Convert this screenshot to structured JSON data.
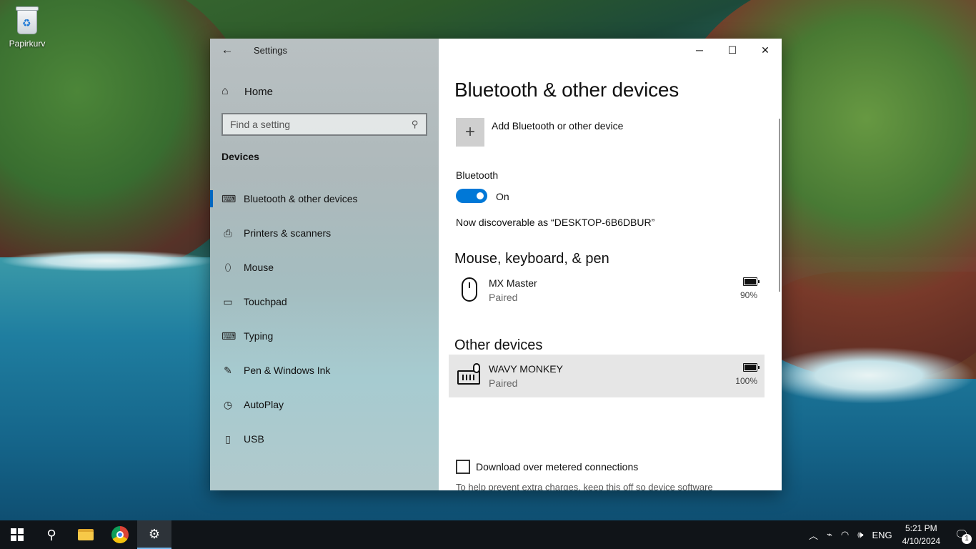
{
  "desktop": {
    "recycle_bin_label": "Papirkurv"
  },
  "window": {
    "title": "Settings",
    "home_label": "Home",
    "search_placeholder": "Find a setting",
    "section_heading": "Devices",
    "nav_items": [
      {
        "label": "Bluetooth & other devices",
        "icon": "bluetooth-devices-icon",
        "active": true
      },
      {
        "label": "Printers & scanners",
        "icon": "printer-icon"
      },
      {
        "label": "Mouse",
        "icon": "mouse-icon"
      },
      {
        "label": "Touchpad",
        "icon": "touchpad-icon"
      },
      {
        "label": "Typing",
        "icon": "keyboard-icon"
      },
      {
        "label": "Pen & Windows Ink",
        "icon": "pen-icon"
      },
      {
        "label": "AutoPlay",
        "icon": "autoplay-icon"
      },
      {
        "label": "USB",
        "icon": "usb-icon"
      }
    ]
  },
  "content": {
    "page_title": "Bluetooth & other devices",
    "add_device_label": "Add Bluetooth or other device",
    "bluetooth_label": "Bluetooth",
    "bluetooth_state": "On",
    "discoverable_text": "Now discoverable as “DESKTOP-6B6DBUR”",
    "group_mouse_keyboard": "Mouse, keyboard, & pen",
    "group_other": "Other devices",
    "devices": [
      {
        "name": "MX Master",
        "status": "Paired",
        "battery": "90%",
        "icon": "mouse-icon"
      },
      {
        "name": "WAVY MONKEY",
        "status": "Paired",
        "battery": "100%",
        "icon": "keyboard-mouse-icon"
      }
    ],
    "metered_label": "Download over metered connections",
    "metered_help": "To help prevent extra charges, keep this off so device software"
  },
  "taskbar": {
    "language": "ENG",
    "time": "5:21 PM",
    "date": "4/10/2024",
    "notification_count": "1"
  },
  "colors": {
    "accent": "#0078d7",
    "nav_indicator": "#0067c0",
    "taskbar": "#101418"
  }
}
